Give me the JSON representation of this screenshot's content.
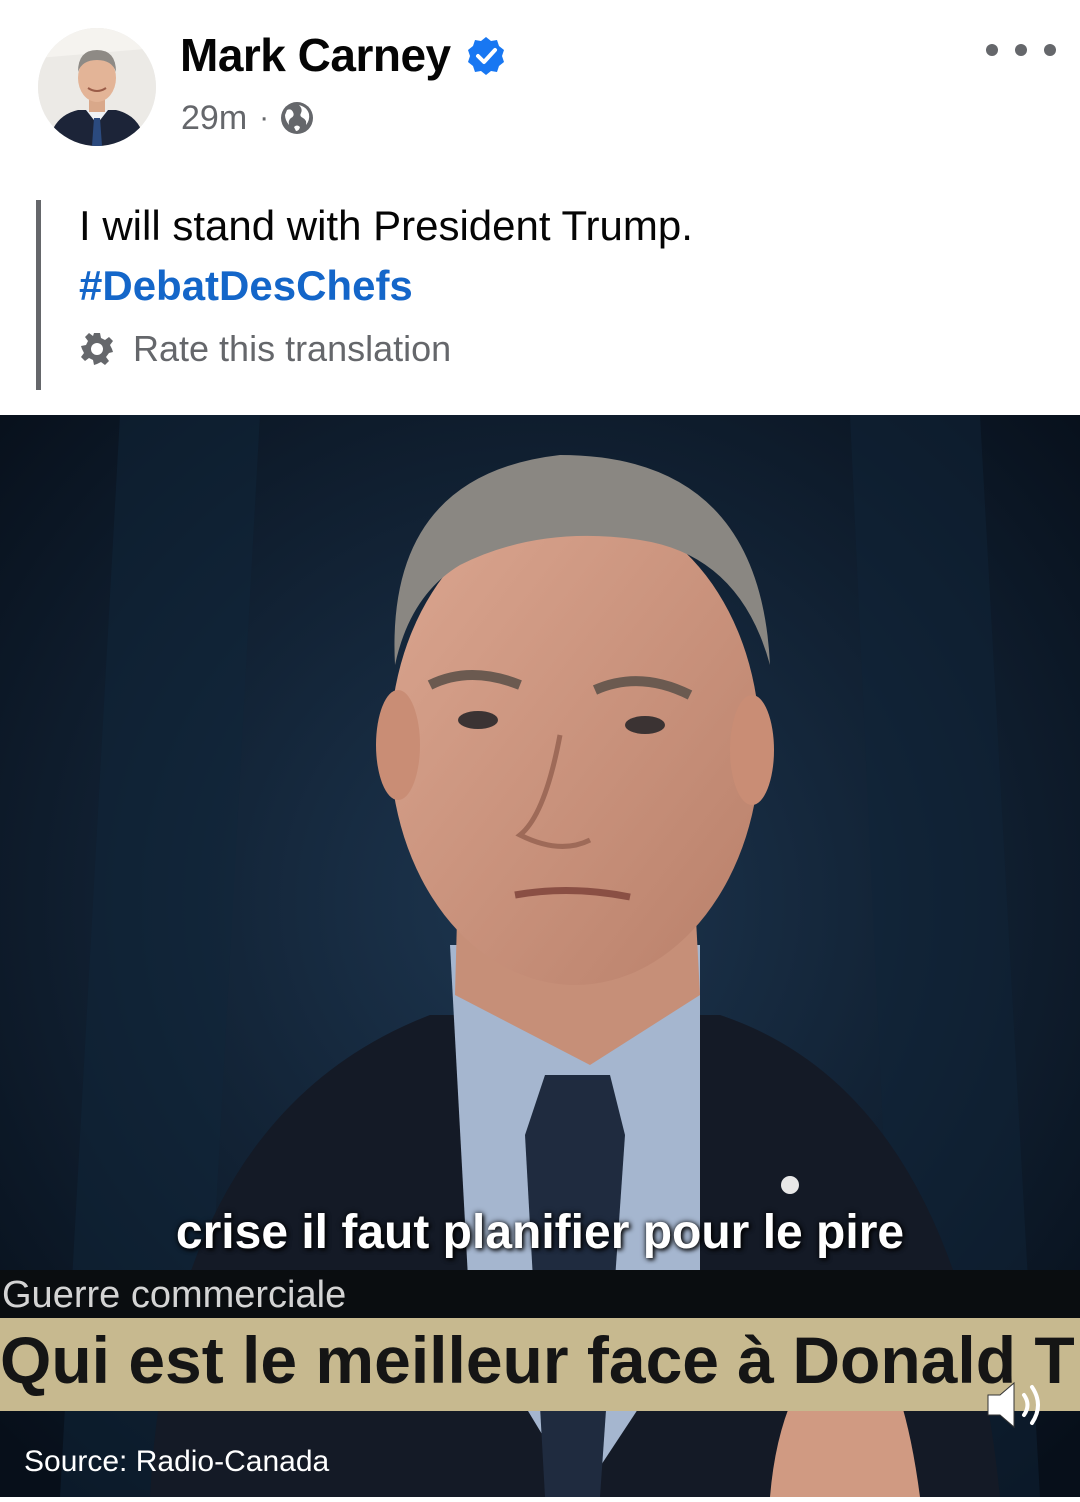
{
  "post": {
    "author": "Mark Carney",
    "timestamp": "29m",
    "separator": "·",
    "text": "I will stand with President Trump.",
    "hashtag": "#DebatDesChefs",
    "rate_translation": "Rate this translation"
  },
  "video": {
    "subtitle": "crise il faut planifier pour le pire",
    "category": "Guerre commerciale",
    "headline": "Qui est le meilleur face à Donald T",
    "source": "Source: Radio-Canada"
  },
  "colors": {
    "verified_badge": "#1877f2",
    "hashtag": "#1466c9",
    "secondary_text": "#65676b",
    "headline_bar": "#c7b98f"
  },
  "icons": [
    "verified-icon",
    "globe-icon",
    "more-icon",
    "gear-icon",
    "volume-icon"
  ]
}
